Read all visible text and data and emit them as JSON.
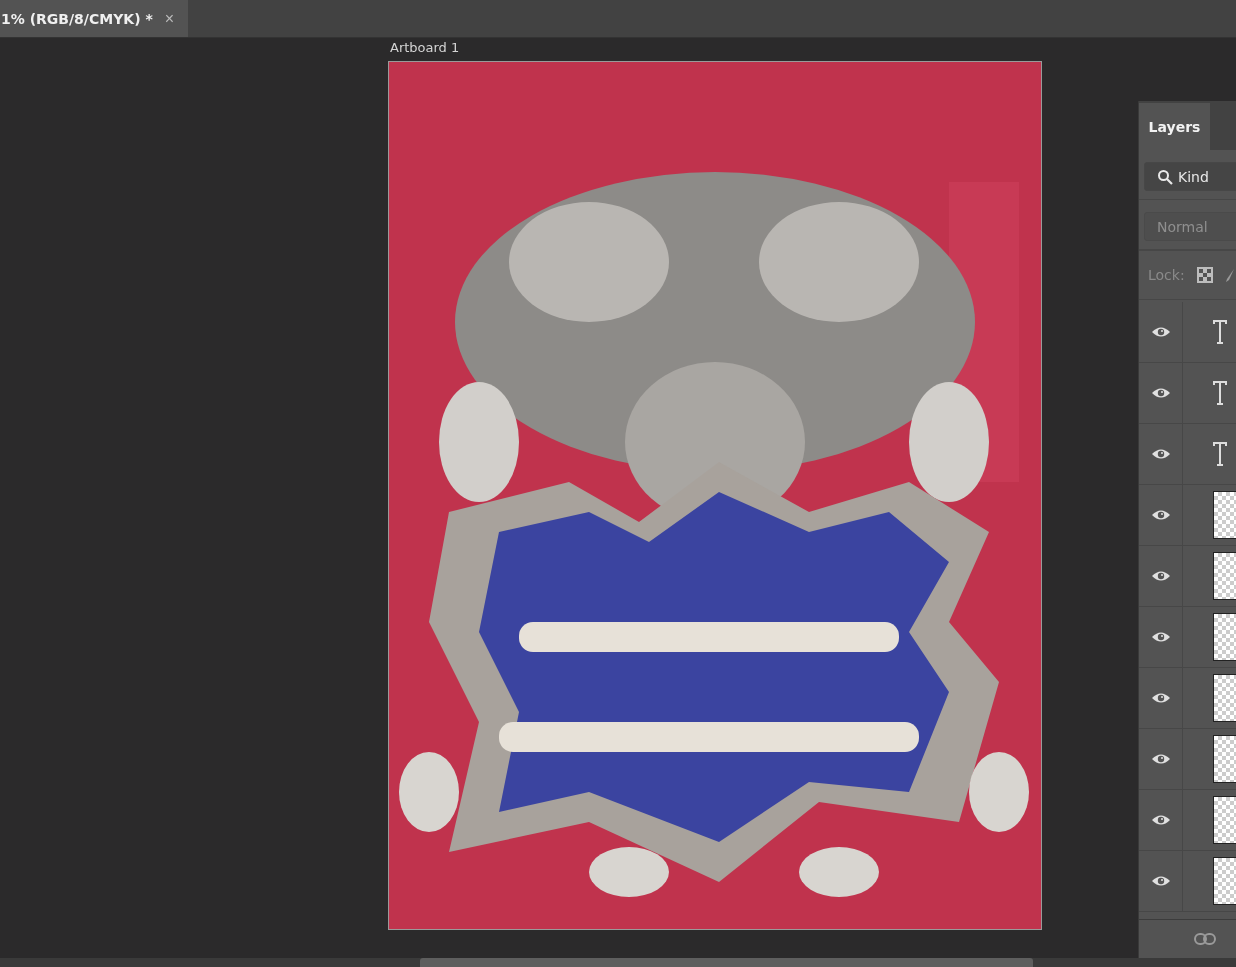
{
  "document_tab": {
    "title": "1% (RGB/8/CMYK) *",
    "close": "×"
  },
  "canvas": {
    "artboard_label": "Artboard 1"
  },
  "layers_panel": {
    "tab": {
      "label": "Layers",
      "selected": true
    },
    "filter": {
      "value": "Kind"
    },
    "blend_mode": {
      "value": "Normal"
    },
    "lock_label": "Lock:",
    "layers": [
      {
        "kind": "text",
        "visible": true
      },
      {
        "kind": "text",
        "visible": true
      },
      {
        "kind": "text",
        "visible": true
      },
      {
        "kind": "pixel",
        "visible": true
      },
      {
        "kind": "pixel",
        "visible": true
      },
      {
        "kind": "pixel",
        "visible": true
      },
      {
        "kind": "pixel",
        "visible": true
      },
      {
        "kind": "pixel",
        "visible": true
      },
      {
        "kind": "pixel",
        "visible": true
      },
      {
        "kind": "pixel",
        "visible": true
      }
    ]
  }
}
